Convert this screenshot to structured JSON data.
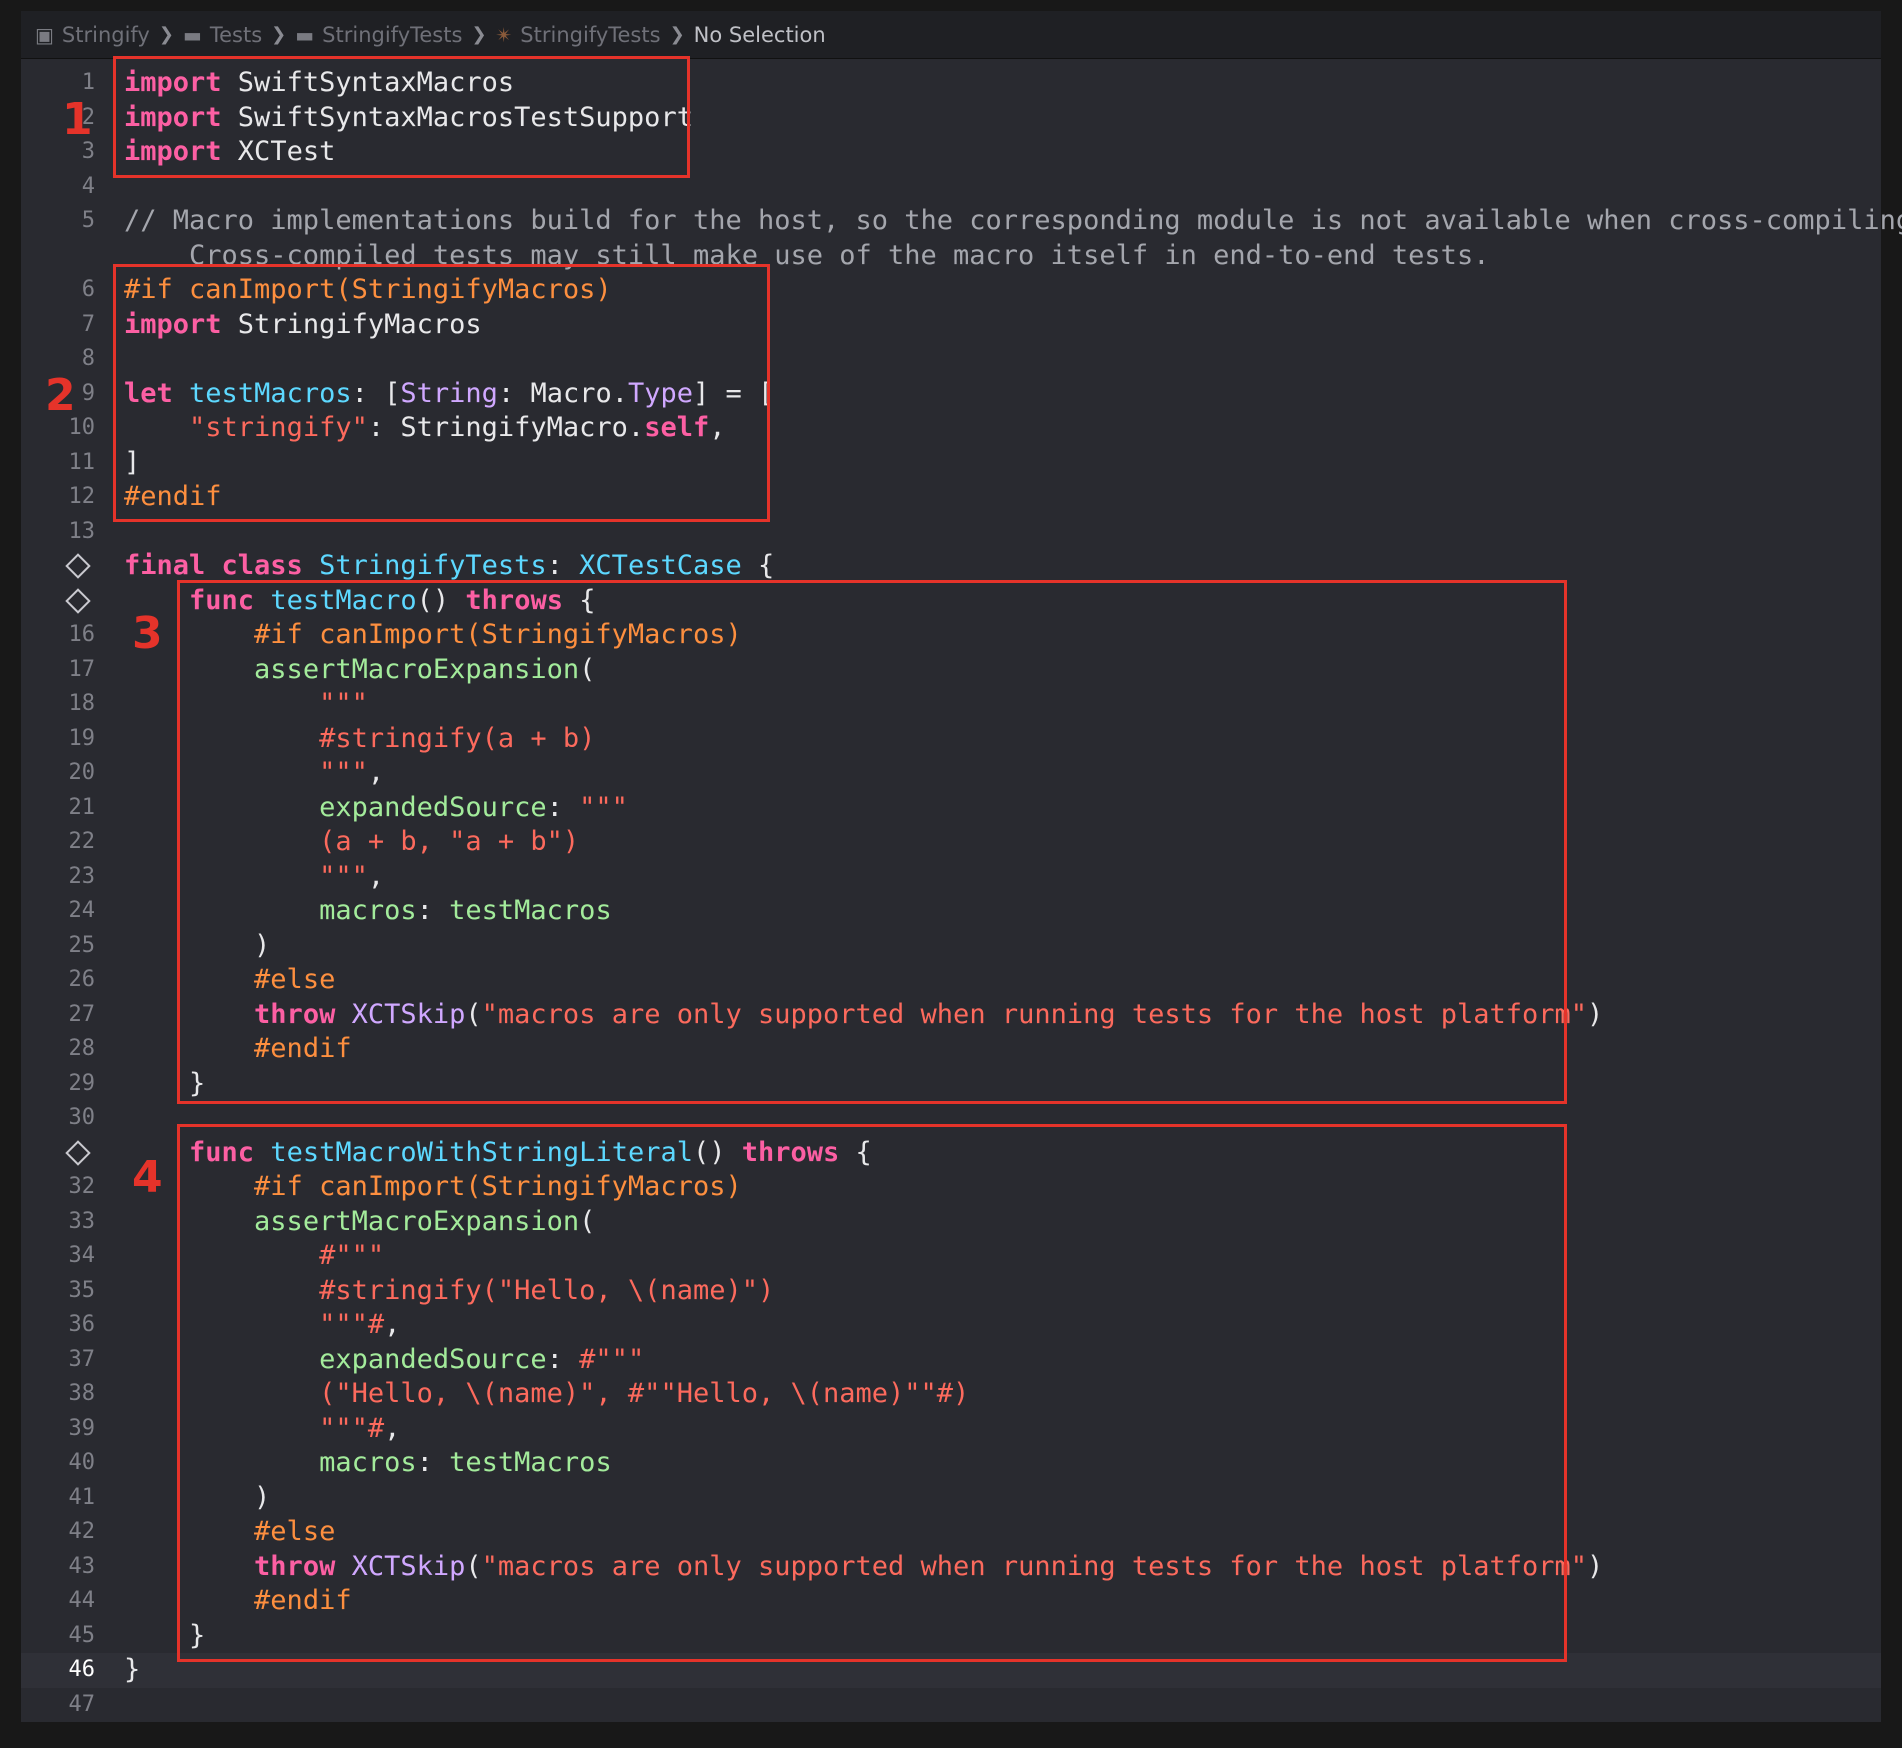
{
  "jumpbar": {
    "crumbs": [
      {
        "label": "Stringify",
        "icon": "package-icon"
      },
      {
        "label": "Tests",
        "icon": "folder-icon"
      },
      {
        "label": "StringifyTests",
        "icon": "folder-icon"
      },
      {
        "label": "StringifyTests",
        "icon": "swift-file-icon"
      },
      {
        "label": "No Selection",
        "icon": ""
      }
    ]
  },
  "editor": {
    "current_line": "46",
    "lines": [
      {
        "n": "1",
        "t": [
          {
            "c": "kw",
            "s": "import"
          },
          {
            "s": " SwiftSyntaxMacros"
          }
        ]
      },
      {
        "n": "2",
        "t": [
          {
            "c": "kw",
            "s": "import"
          },
          {
            "s": " SwiftSyntaxMacrosTestSupport"
          }
        ]
      },
      {
        "n": "3",
        "t": [
          {
            "c": "kw",
            "s": "import"
          },
          {
            "s": " XCTest"
          }
        ]
      },
      {
        "n": "4",
        "t": []
      },
      {
        "n": "5",
        "t": [
          {
            "c": "cm",
            "s": "// Macro implementations build for the host, so the corresponding module is not available when cross-compiling."
          }
        ]
      },
      {
        "n": "",
        "t": [
          {
            "c": "cm",
            "s": "    Cross-compiled tests may still make use of the macro itself in end-to-end tests."
          }
        ]
      },
      {
        "n": "6",
        "t": [
          {
            "c": "pp",
            "s": "#if canImport(StringifyMacros)"
          }
        ]
      },
      {
        "n": "7",
        "t": [
          {
            "c": "kw",
            "s": "import"
          },
          {
            "s": " StringifyMacros"
          }
        ]
      },
      {
        "n": "8",
        "t": []
      },
      {
        "n": "9",
        "t": [
          {
            "c": "kw",
            "s": "let"
          },
          {
            "s": " "
          },
          {
            "c": "dec",
            "s": "testMacros"
          },
          {
            "s": ": ["
          },
          {
            "c": "typ",
            "s": "String"
          },
          {
            "s": ": Macro."
          },
          {
            "c": "typ",
            "s": "Type"
          },
          {
            "s": "] = ["
          }
        ]
      },
      {
        "n": "10",
        "t": [
          {
            "s": "    "
          },
          {
            "c": "str",
            "s": "\"stringify\""
          },
          {
            "s": ": StringifyMacro."
          },
          {
            "c": "kw",
            "s": "self"
          },
          {
            "s": ","
          }
        ]
      },
      {
        "n": "11",
        "t": [
          {
            "s": "]"
          }
        ]
      },
      {
        "n": "12",
        "t": [
          {
            "c": "pp",
            "s": "#endif"
          }
        ]
      },
      {
        "n": "13",
        "t": []
      },
      {
        "n": "",
        "d": true,
        "t": [
          {
            "c": "kw",
            "s": "final class"
          },
          {
            "s": " "
          },
          {
            "c": "dec",
            "s": "StringifyTests"
          },
          {
            "s": ": "
          },
          {
            "c": "dec",
            "s": "XCTestCase"
          },
          {
            "s": " {"
          }
        ]
      },
      {
        "n": "",
        "d": true,
        "t": [
          {
            "s": "    "
          },
          {
            "c": "kw",
            "s": "func"
          },
          {
            "s": " "
          },
          {
            "c": "dec",
            "s": "testMacro"
          },
          {
            "s": "() "
          },
          {
            "c": "kw",
            "s": "throws"
          },
          {
            "s": " {"
          }
        ]
      },
      {
        "n": "16",
        "t": [
          {
            "s": "        "
          },
          {
            "c": "pp",
            "s": "#if canImport(StringifyMacros)"
          }
        ]
      },
      {
        "n": "17",
        "t": [
          {
            "s": "        "
          },
          {
            "c": "ot",
            "s": "assertMacroExpansion"
          },
          {
            "s": "("
          }
        ]
      },
      {
        "n": "18",
        "t": [
          {
            "s": "            "
          },
          {
            "c": "str",
            "s": "\"\"\""
          }
        ]
      },
      {
        "n": "19",
        "t": [
          {
            "s": "            "
          },
          {
            "c": "str",
            "s": "#stringify(a + b)"
          }
        ]
      },
      {
        "n": "20",
        "t": [
          {
            "s": "            "
          },
          {
            "c": "str",
            "s": "\"\"\""
          },
          {
            "s": ","
          }
        ]
      },
      {
        "n": "21",
        "t": [
          {
            "s": "            "
          },
          {
            "c": "ot",
            "s": "expandedSource"
          },
          {
            "s": ": "
          },
          {
            "c": "str",
            "s": "\"\"\""
          }
        ]
      },
      {
        "n": "22",
        "t": [
          {
            "s": "            "
          },
          {
            "c": "str",
            "s": "(a + b, \"a + b\")"
          }
        ]
      },
      {
        "n": "23",
        "t": [
          {
            "s": "            "
          },
          {
            "c": "str",
            "s": "\"\"\""
          },
          {
            "s": ","
          }
        ]
      },
      {
        "n": "24",
        "t": [
          {
            "s": "            "
          },
          {
            "c": "ot",
            "s": "macros"
          },
          {
            "s": ": "
          },
          {
            "c": "ot",
            "s": "testMacros"
          }
        ]
      },
      {
        "n": "25",
        "t": [
          {
            "s": "        )"
          }
        ]
      },
      {
        "n": "26",
        "t": [
          {
            "s": "        "
          },
          {
            "c": "pp",
            "s": "#else"
          }
        ]
      },
      {
        "n": "27",
        "t": [
          {
            "s": "        "
          },
          {
            "c": "kw",
            "s": "throw"
          },
          {
            "s": " "
          },
          {
            "c": "typ",
            "s": "XCTSkip"
          },
          {
            "s": "("
          },
          {
            "c": "str",
            "s": "\"macros are only supported when running tests for the host platform\""
          },
          {
            "s": ")"
          }
        ]
      },
      {
        "n": "28",
        "t": [
          {
            "s": "        "
          },
          {
            "c": "pp",
            "s": "#endif"
          }
        ]
      },
      {
        "n": "29",
        "t": [
          {
            "s": "    }"
          }
        ]
      },
      {
        "n": "30",
        "t": []
      },
      {
        "n": "",
        "d": true,
        "t": [
          {
            "s": "    "
          },
          {
            "c": "kw",
            "s": "func"
          },
          {
            "s": " "
          },
          {
            "c": "dec",
            "s": "testMacroWithStringLiteral"
          },
          {
            "s": "() "
          },
          {
            "c": "kw",
            "s": "throws"
          },
          {
            "s": " {"
          }
        ]
      },
      {
        "n": "32",
        "t": [
          {
            "s": "        "
          },
          {
            "c": "pp",
            "s": "#if canImport(StringifyMacros)"
          }
        ]
      },
      {
        "n": "33",
        "t": [
          {
            "s": "        "
          },
          {
            "c": "ot",
            "s": "assertMacroExpansion"
          },
          {
            "s": "("
          }
        ]
      },
      {
        "n": "34",
        "t": [
          {
            "s": "            "
          },
          {
            "c": "str",
            "s": "#\"\"\""
          }
        ]
      },
      {
        "n": "35",
        "t": [
          {
            "s": "            "
          },
          {
            "c": "str",
            "s": "#stringify(\"Hello, \\(name)\")"
          }
        ]
      },
      {
        "n": "36",
        "t": [
          {
            "s": "            "
          },
          {
            "c": "str",
            "s": "\"\"\"#"
          },
          {
            "s": ","
          }
        ]
      },
      {
        "n": "37",
        "t": [
          {
            "s": "            "
          },
          {
            "c": "ot",
            "s": "expandedSource"
          },
          {
            "s": ": "
          },
          {
            "c": "str",
            "s": "#\"\"\""
          }
        ]
      },
      {
        "n": "38",
        "t": [
          {
            "s": "            "
          },
          {
            "c": "str",
            "s": "(\"Hello, \\(name)\", #\"\"Hello, \\(name)\"\"#)"
          }
        ]
      },
      {
        "n": "39",
        "t": [
          {
            "s": "            "
          },
          {
            "c": "str",
            "s": "\"\"\"#"
          },
          {
            "s": ","
          }
        ]
      },
      {
        "n": "40",
        "t": [
          {
            "s": "            "
          },
          {
            "c": "ot",
            "s": "macros"
          },
          {
            "s": ": "
          },
          {
            "c": "ot",
            "s": "testMacros"
          }
        ]
      },
      {
        "n": "41",
        "t": [
          {
            "s": "        )"
          }
        ]
      },
      {
        "n": "42",
        "t": [
          {
            "s": "        "
          },
          {
            "c": "pp",
            "s": "#else"
          }
        ]
      },
      {
        "n": "43",
        "t": [
          {
            "s": "        "
          },
          {
            "c": "kw",
            "s": "throw"
          },
          {
            "s": " "
          },
          {
            "c": "typ",
            "s": "XCTSkip"
          },
          {
            "s": "("
          },
          {
            "c": "str",
            "s": "\"macros are only supported when running tests for the host platform\""
          },
          {
            "s": ")"
          }
        ]
      },
      {
        "n": "44",
        "t": [
          {
            "s": "        "
          },
          {
            "c": "pp",
            "s": "#endif"
          }
        ]
      },
      {
        "n": "45",
        "t": [
          {
            "s": "    }"
          }
        ]
      },
      {
        "n": "46",
        "t": [
          {
            "s": "}"
          }
        ]
      },
      {
        "n": "47",
        "t": []
      }
    ]
  },
  "annotations": [
    {
      "label": "1",
      "color": "#e5332a"
    },
    {
      "label": "2",
      "color": "#e5332a"
    },
    {
      "label": "3",
      "color": "#e5332a"
    },
    {
      "label": "4",
      "color": "#e5332a"
    }
  ]
}
